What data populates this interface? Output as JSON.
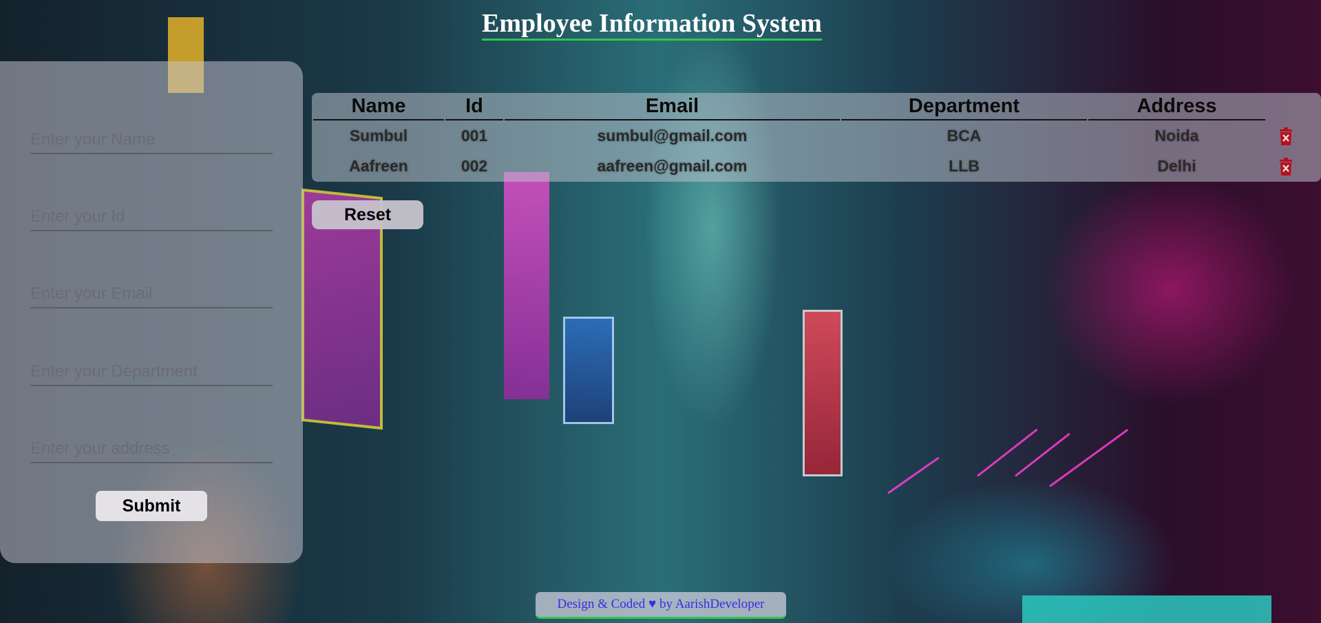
{
  "header": {
    "title": "Employee Information System"
  },
  "form": {
    "name_placeholder": "Enter your Name",
    "id_placeholder": "Enter your Id",
    "email_placeholder": "Enter your Email",
    "department_placeholder": "Enter your Department",
    "address_placeholder": "Enter your address",
    "submit_label": "Submit"
  },
  "table": {
    "columns": [
      "Name",
      "Id",
      "Email",
      "Department",
      "Address"
    ],
    "rows": [
      {
        "name": "Sumbul",
        "id": "001",
        "email": "sumbul@gmail.com",
        "department": "BCA",
        "address": "Noida",
        "delete_icon": "trash-icon"
      },
      {
        "name": "Aafreen",
        "id": "002",
        "email": "aafreen@gmail.com",
        "department": "LLB",
        "address": "Delhi",
        "delete_icon": "trash-icon"
      }
    ]
  },
  "reset_label": "Reset",
  "footer": {
    "text": "Design & Coded ♥ by AarishDeveloper"
  },
  "colors": {
    "title_underline": "#2fc74c",
    "delete_icon": "#b5121b",
    "footer_text": "#3a2de0"
  }
}
